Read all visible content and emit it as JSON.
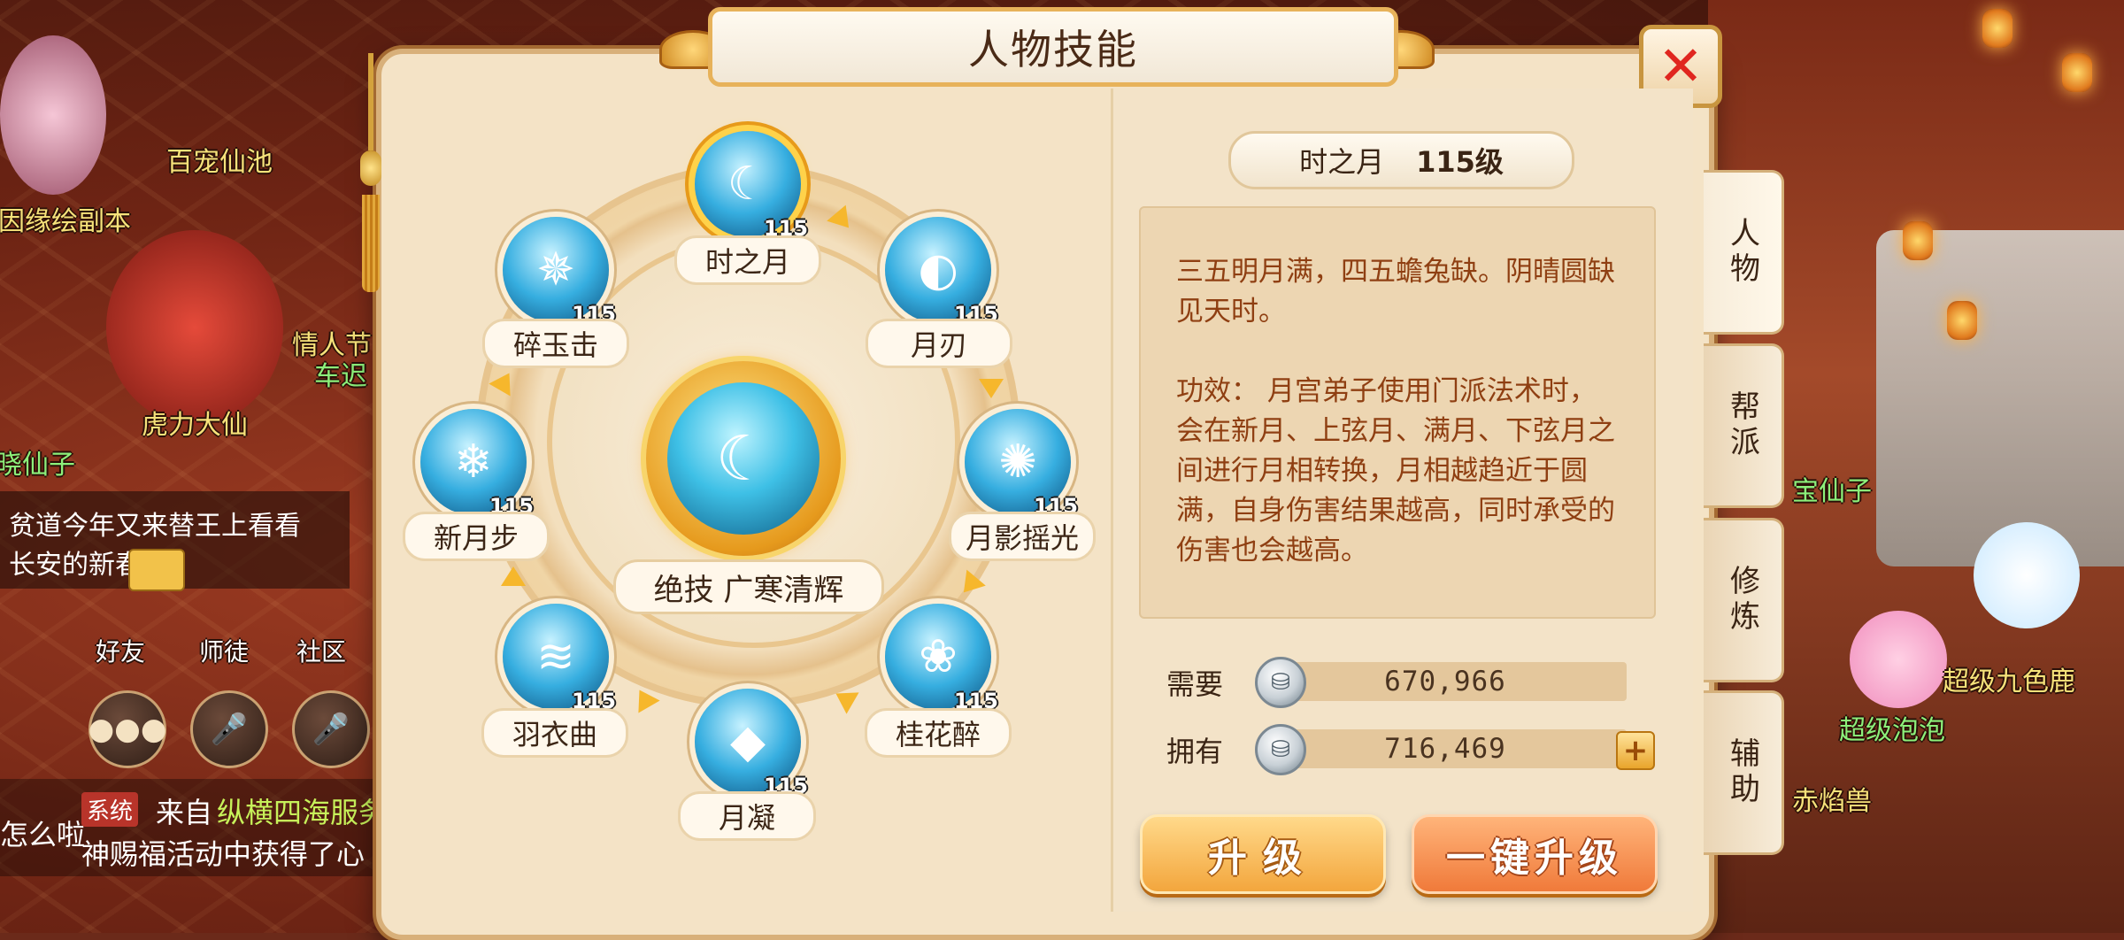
{
  "world": {
    "labels": [
      {
        "text": "百宠仙池",
        "color": "yellow"
      },
      {
        "text": "因缘绘副本",
        "color": "yellow"
      },
      {
        "text": "情人节",
        "color": "yellow"
      },
      {
        "text": "车迟",
        "color": "green"
      },
      {
        "text": "虎力大仙",
        "color": "yellow"
      },
      {
        "text": "晓仙子",
        "color": "green"
      },
      {
        "text": "宝仙子",
        "color": "green"
      },
      {
        "text": "超级九色鹿",
        "color": "yellow"
      },
      {
        "text": "超级泡泡",
        "color": "green"
      },
      {
        "text": "赤焰兽",
        "color": "yellow"
      },
      {
        "text": "好友",
        "color": "white"
      },
      {
        "text": "师徒",
        "color": "white"
      },
      {
        "text": "社区",
        "color": "white"
      }
    ],
    "chat": {
      "line1": "贫道今年又来替王上看看",
      "line2": "长安的新春集。"
    },
    "system": {
      "tag": "系统",
      "prefix": "怎么啦",
      "from": "来自",
      "server": "纵横四海服务",
      "line2": "神赐福活动中获得了心"
    },
    "colors": {
      "label_yellow": "#f6e27a",
      "label_green": "#8cf07a",
      "system_red": "#b8342a"
    }
  },
  "dialog": {
    "title": "人物技能",
    "close_icon": "close-icon",
    "center_skill": {
      "label": "绝技 广寒清辉",
      "icon": "moon-crescent-icon"
    },
    "skills": [
      {
        "name": "时之月",
        "level": "115",
        "selected": true,
        "icon": "moon-icon"
      },
      {
        "name": "月刃",
        "level": "115",
        "selected": false,
        "icon": "blade-icon"
      },
      {
        "name": "月影摇光",
        "level": "115",
        "selected": false,
        "icon": "glow-icon"
      },
      {
        "name": "桂花醉",
        "level": "115",
        "selected": false,
        "icon": "flower-icon"
      },
      {
        "name": "月凝",
        "level": "115",
        "selected": false,
        "icon": "crystal-icon"
      },
      {
        "name": "羽衣曲",
        "level": "115",
        "selected": false,
        "icon": "wave-icon"
      },
      {
        "name": "新月步",
        "level": "115",
        "selected": false,
        "icon": "snowflake-icon"
      },
      {
        "name": "碎玉击",
        "level": "115",
        "selected": false,
        "icon": "shatter-icon"
      }
    ],
    "detail": {
      "name": "时之月",
      "level": "115级",
      "description_1": "三五明月满，四五蟾兔缺。阴晴圆缺见天时。",
      "description_2": "功效：  月宫弟子使用门派法术时，会在新月、上弦月、满月、下弦月之间进行月相转换，月相越趋近于圆满，自身伤害结果越高，同时承受的伤害也会越高。"
    },
    "cost": {
      "need_label": "需要",
      "need_value": "670,966",
      "have_label": "拥有",
      "have_value": "716,469",
      "currency_icon": "silver-coin-icon"
    },
    "buttons": {
      "upgrade": "升级",
      "one_click": "一键升级"
    },
    "tabs": [
      "人物",
      "帮派",
      "修炼",
      "辅助"
    ]
  }
}
